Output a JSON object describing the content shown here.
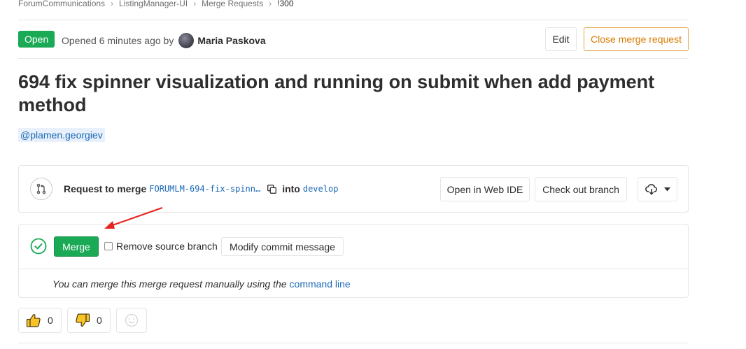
{
  "breadcrumb": [
    "ForumCommunications",
    "ListingManager-UI",
    "Merge Requests",
    "!300"
  ],
  "header": {
    "status": "Open",
    "opened_prefix": "Opened 6 minutes ago by",
    "author": "Maria Paskova",
    "edit_label": "Edit",
    "close_label": "Close merge request"
  },
  "title": "694 fix spinner visualization and running on submit when add payment method",
  "mention": "@plamen.georgiev",
  "merge_info": {
    "request_label": "Request to merge",
    "source_branch": "FORUMLM-694-fix-spinn…",
    "into_label": "into",
    "target_branch": "develop",
    "web_ide_label": "Open in Web IDE",
    "checkout_label": "Check out branch"
  },
  "merge_widget": {
    "merge_label": "Merge",
    "remove_source_label": "Remove source branch",
    "remove_source_checked": false,
    "modify_commit_label": "Modify commit message",
    "manual_text": "You can merge this merge request manually using the",
    "manual_link": "command line"
  },
  "votes": {
    "thumbs_up": "0",
    "thumbs_down": "0"
  },
  "colors": {
    "success": "#1aaa55",
    "warning": "#d97b00",
    "link": "#1b69b6",
    "annotation_arrow": "#e8231f"
  },
  "icons": [
    "chevron-right-icon",
    "avatar",
    "merge-request-icon",
    "copy-icon",
    "download-cloud-icon",
    "caret-down-icon",
    "check-circle-icon",
    "thumbs-up-icon",
    "thumbs-down-icon",
    "smiley-icon"
  ]
}
